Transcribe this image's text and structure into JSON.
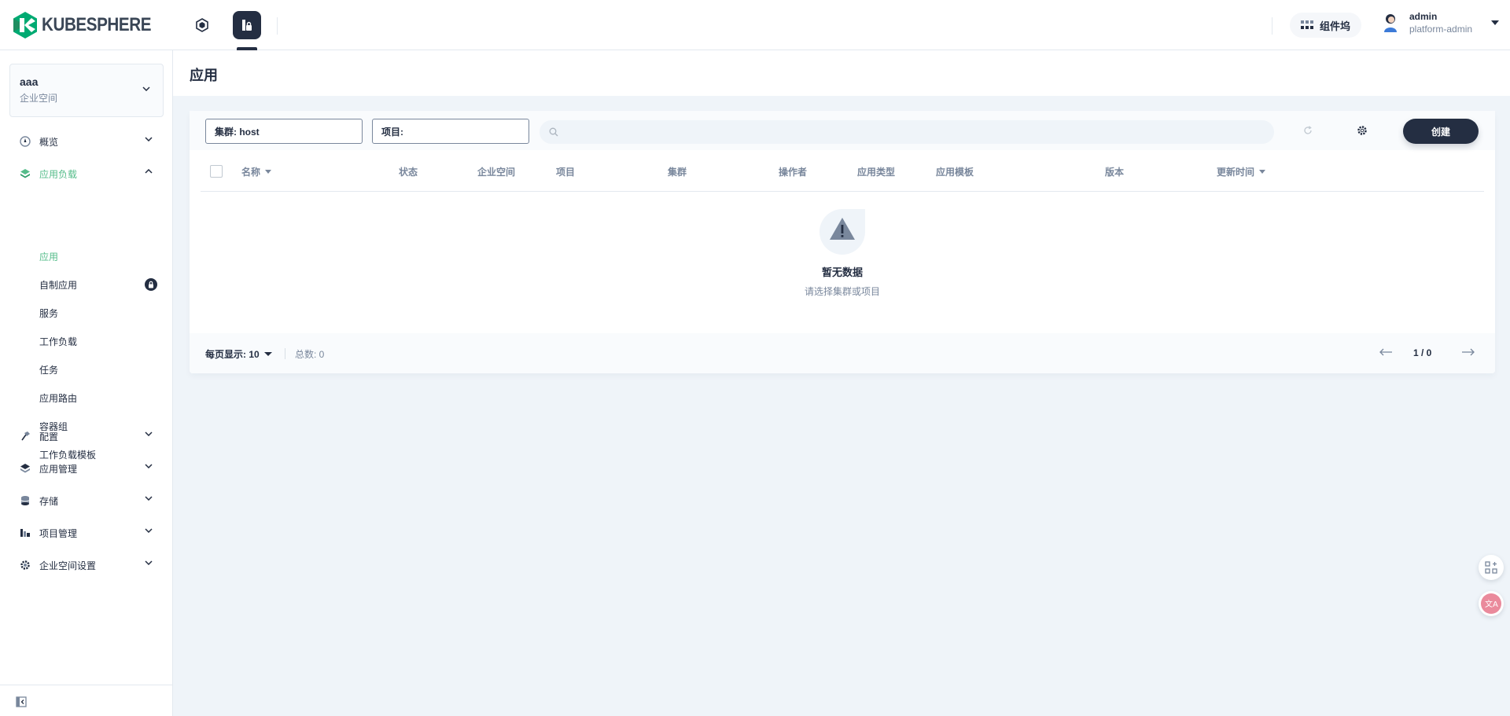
{
  "header": {
    "logo_text": "KUBESPHERE",
    "components_label": "组件坞",
    "user": {
      "name": "admin",
      "role": "platform-admin"
    }
  },
  "sidebar": {
    "workspace": {
      "name": "aaa",
      "type": "企业空间"
    },
    "nav": [
      {
        "label": "概览",
        "icon": "dashboard-icon"
      },
      {
        "label": "应用负载",
        "icon": "appcenter-icon",
        "open": true
      },
      {
        "label": "配置",
        "icon": "hammer-icon"
      },
      {
        "label": "应用管理",
        "icon": "appcenter-icon"
      },
      {
        "label": "存储",
        "icon": "database-icon"
      },
      {
        "label": "项目管理",
        "icon": "project-icon"
      },
      {
        "label": "企业空间设置",
        "icon": "gear-icon"
      }
    ],
    "sub_items": [
      {
        "label": "应用",
        "active": true
      },
      {
        "label": "自制应用",
        "locked": true
      },
      {
        "label": "服务"
      },
      {
        "label": "工作负载"
      },
      {
        "label": "任务"
      },
      {
        "label": "应用路由"
      },
      {
        "label": "容器组"
      },
      {
        "label": "工作负载模板"
      }
    ]
  },
  "page": {
    "title": "应用",
    "cluster_select": "集群:  host",
    "project_select": "项目:",
    "search_placeholder": "",
    "create_label": "创建",
    "columns": [
      "名称",
      "状态",
      "企业空间",
      "项目",
      "集群",
      "操作者",
      "应用类型",
      "应用模板",
      "版本",
      "更新时间"
    ],
    "empty": {
      "title": "暂无数据",
      "subtitle": "请选择集群或项目"
    },
    "pagination": {
      "per_page_label": "每页显示: 10",
      "total_label": "总数: 0",
      "page_label": "1 / 0"
    }
  },
  "colors": {
    "accent_green": "#55bc8a",
    "dark": "#242e42",
    "muted": "#79879c",
    "background": "#eff4f9"
  }
}
